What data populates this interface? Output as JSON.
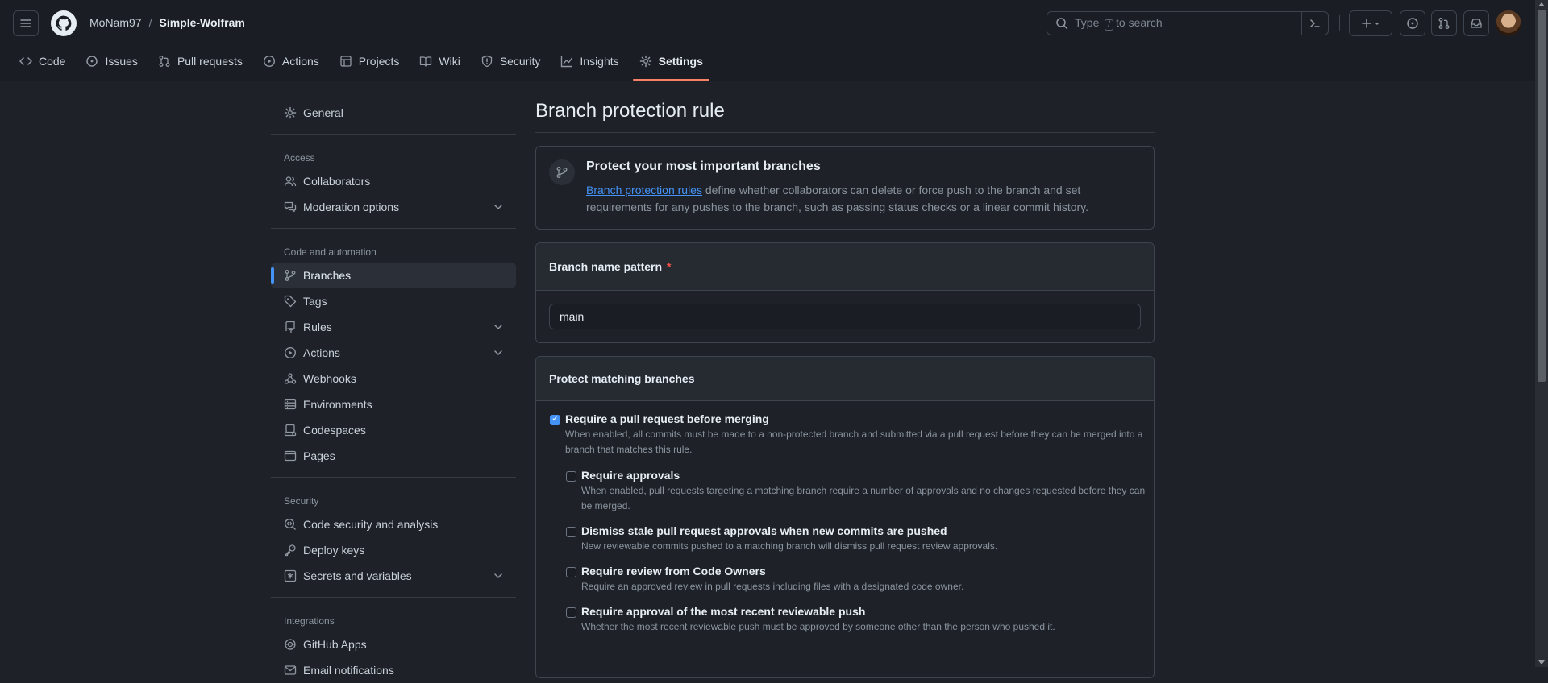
{
  "header": {
    "owner": "MoNam97",
    "separator": "/",
    "repo": "Simple-Wolfram",
    "search": {
      "before": "Type",
      "key": "/",
      "after": "to search"
    }
  },
  "repo_tabs": [
    {
      "label": "Code",
      "icon": "code-icon"
    },
    {
      "label": "Issues",
      "icon": "issue-icon"
    },
    {
      "label": "Pull requests",
      "icon": "pull-request-icon"
    },
    {
      "label": "Actions",
      "icon": "play-icon"
    },
    {
      "label": "Projects",
      "icon": "table-icon"
    },
    {
      "label": "Wiki",
      "icon": "book-icon"
    },
    {
      "label": "Security",
      "icon": "shield-icon"
    },
    {
      "label": "Insights",
      "icon": "graph-icon"
    },
    {
      "label": "Settings",
      "icon": "gear-icon",
      "active": true
    }
  ],
  "sidebar": {
    "general": "General",
    "access_heading": "Access",
    "collaborators": "Collaborators",
    "moderation": "Moderation options",
    "code_heading": "Code and automation",
    "branches": "Branches",
    "tags": "Tags",
    "rules": "Rules",
    "actions": "Actions",
    "webhooks": "Webhooks",
    "environments": "Environments",
    "codespaces": "Codespaces",
    "pages": "Pages",
    "security_heading": "Security",
    "code_security": "Code security and analysis",
    "deploy_keys": "Deploy keys",
    "secrets": "Secrets and variables",
    "integrations_heading": "Integrations",
    "github_apps": "GitHub Apps",
    "email_notifications": "Email notifications"
  },
  "main": {
    "title": "Branch protection rule",
    "info": {
      "heading": "Protect your most important branches",
      "link": "Branch protection rules",
      "text": " define whether collaborators can delete or force push to the branch and set requirements for any pushes to the branch, such as passing status checks or a linear commit history."
    },
    "pattern": {
      "label": "Branch name pattern",
      "required": "*",
      "value": "main"
    },
    "protect": {
      "heading": "Protect matching branches",
      "options": [
        {
          "label": "Require a pull request before merging",
          "desc": "When enabled, all commits must be made to a non-protected branch and submitted via a pull request before they can be merged into a branch that matches this rule.",
          "checked": true
        },
        {
          "label": "Require approvals",
          "desc": "When enabled, pull requests targeting a matching branch require a number of approvals and no changes requested before they can be merged.",
          "checked": false
        },
        {
          "label": "Dismiss stale pull request approvals when new commits are pushed",
          "desc": "New reviewable commits pushed to a matching branch will dismiss pull request review approvals.",
          "checked": false
        },
        {
          "label": "Require review from Code Owners",
          "desc": "Require an approved review in pull requests including files with a designated code owner.",
          "checked": false
        },
        {
          "label": "Require approval of the most recent reviewable push",
          "desc": "Whether the most recent reviewable push must be approved by someone other than the person who pushed it.",
          "checked": false
        }
      ]
    }
  },
  "colors": {
    "accent": "#4493f8",
    "tab_underline": "#f78166",
    "background": "#1e2228"
  }
}
